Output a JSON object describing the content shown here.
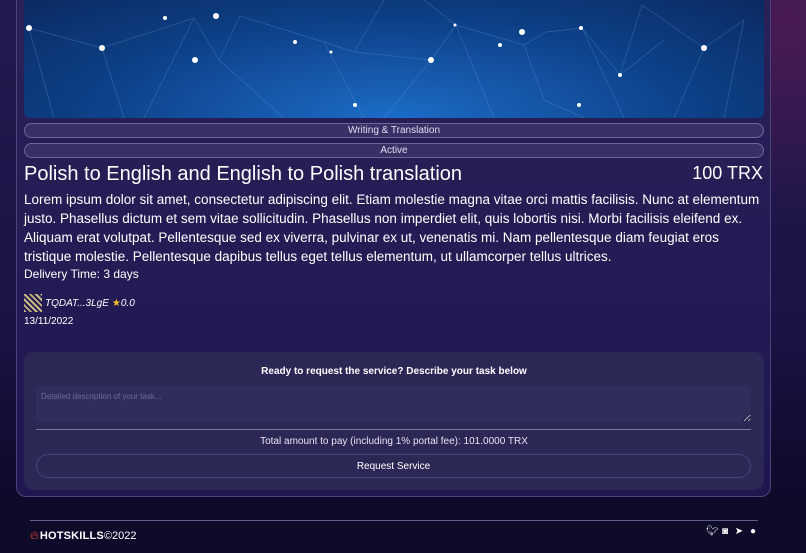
{
  "service": {
    "category": "Writing & Translation",
    "status": "Active",
    "title": "Polish to English and English to Polish translation",
    "price": "100 TRX",
    "description": "Lorem ipsum dolor sit amet, consectetur adipiscing elit. Etiam molestie magna vitae orci mattis facilisis. Nunc at elementum justo. Phasellus dictum et sem vitae sollicitudin. Phasellus non imperdiet elit, quis lobortis nisi. Morbi facilisis eleifend ex. Aliquam erat volutpat. Pellentesque sed ex viverra, pulvinar ex ut, venenatis mi. Nam pellentesque diam feugiat eros tristique molestie. Pellentesque dapibus tellus eget tellus elementum, ut ullamcorper tellus ultrices.",
    "delivery": "Delivery Time: 3 days",
    "seller": "TQDAT...3LgE",
    "rating": "0.0",
    "date": "13/11/2022"
  },
  "request": {
    "heading": "Ready to request the service? Describe your task below",
    "placeholder": "Detailed description of your task...",
    "total": "Total amount to pay (including 1% portal fee): 101.0000 TRX",
    "button": "Request Service"
  },
  "footer": {
    "brand": "HOTSKILLS",
    "copyright": "©2022",
    "icons": [
      "twitter-icon",
      "discord-icon",
      "telegram-icon",
      "github-icon"
    ]
  }
}
